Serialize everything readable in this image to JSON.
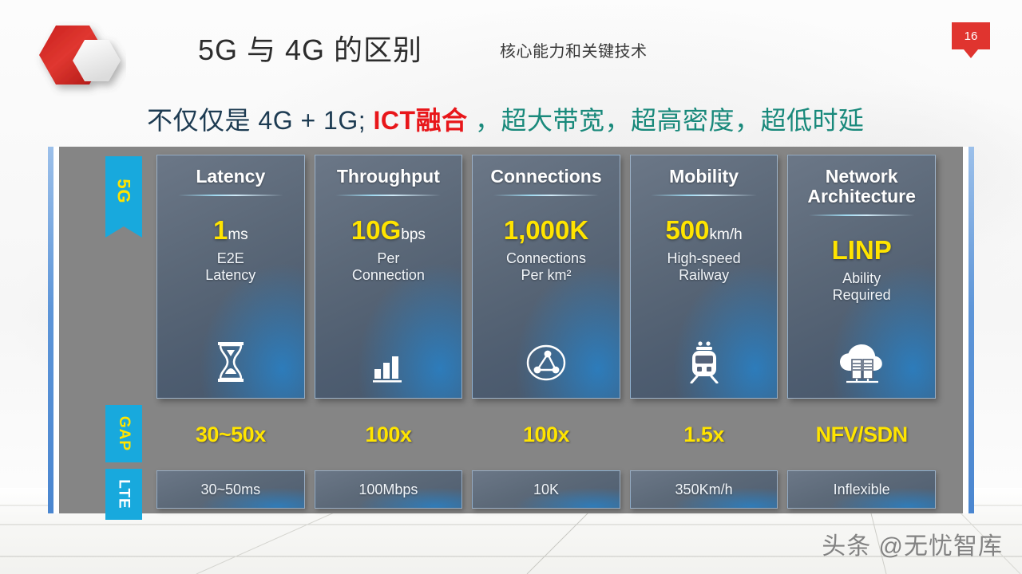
{
  "header": {
    "title": "5G 与 4G 的区别",
    "subtitle": "核心能力和关键技术",
    "page_number": "16",
    "logo_name": "hexagon-logo"
  },
  "headline": {
    "part_dark": "不仅仅是 4G + 1G;",
    "part_red": "ICT融合",
    "part_teal": "，超大带宽，超高密度，超低时延"
  },
  "rows": {
    "label_5g": "5G",
    "label_gap": "GAP",
    "label_lte": "LTE"
  },
  "cards": [
    {
      "title": "Latency",
      "figure_value": "1",
      "figure_unit": "ms",
      "desc": "E2E\nLatency",
      "icon": "hourglass-icon"
    },
    {
      "title": "Throughput",
      "figure_value": "10G",
      "figure_unit": "bps",
      "desc": "Per\nConnection",
      "icon": "bar-chart-icon"
    },
    {
      "title": "Connections",
      "figure_value": "1,000K",
      "figure_unit": "",
      "desc": "Connections\nPer km²",
      "icon": "network-nodes-icon"
    },
    {
      "title": "Mobility",
      "figure_value": "500",
      "figure_unit": "km/h",
      "desc": "High-speed\nRailway",
      "icon": "train-icon"
    },
    {
      "title": "Network\nArchitecture",
      "figure_value": "LINP",
      "figure_unit": "",
      "desc": "Ability\nRequired",
      "icon": "cloud-servers-icon"
    }
  ],
  "gap_values": [
    "30~50x",
    "100x",
    "100x",
    "1.5x",
    "NFV/SDN"
  ],
  "lte_values": [
    "30~50ms",
    "100Mbps",
    "10K",
    "350Km/h",
    "Inflexible"
  ],
  "watermark": "头条 @无忧智库",
  "colors": {
    "accent_cyan": "#18a9dd",
    "highlight_yellow": "#ffe400",
    "brand_red": "#e0342f",
    "headline_red": "#e8161a",
    "headline_teal": "#19897b",
    "panel_grey": "#858585",
    "rail_blue": "#5d95d8"
  }
}
